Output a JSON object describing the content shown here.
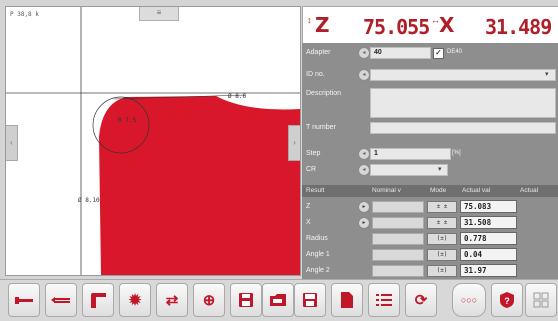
{
  "canvas": {
    "coord_label": "P 38,8 k",
    "top_handle_icon": "drag-handle-icon",
    "left_handle_icon": "chevron-left-icon",
    "right_handle_icon": "chevron-right-icon",
    "radius_label": "R 7.5",
    "width_label": "Ø 8.10",
    "dim_label": "Ø 8.6",
    "shape_color": "#d8182a"
  },
  "readout": {
    "z_icon": "↕",
    "z_name": "Z",
    "z_value": "75.055",
    "x_icon": "↔",
    "x_name": "X",
    "x_value": "31.489",
    "value_color": "#b0202a"
  },
  "panel": {
    "adapter_label": "Adapter",
    "adapter_value": "40",
    "adapter_check_label": "DE40",
    "id_label": "ID no.",
    "description_label": "Description",
    "t_number_label": "T number",
    "step_label": "Step",
    "step_value": "1",
    "step_unit": "[%]",
    "cr_label": "CR",
    "table_headers": [
      "Result",
      "Nominal v",
      "Mode",
      "Actual val",
      "Actual"
    ],
    "rows": [
      {
        "label": "Z",
        "mode": "±  ±",
        "actual": "75.083"
      },
      {
        "label": "X",
        "mode": "±  ±",
        "actual": "31.508"
      },
      {
        "label": "Radius",
        "mode": "(±)",
        "actual": "0.778"
      },
      {
        "label": "Angle 1",
        "mode": "(±)",
        "actual": "0.04"
      },
      {
        "label": "Angle 2",
        "mode": "(±)",
        "actual": "31.97"
      }
    ]
  },
  "toolbar": {
    "buttons": [
      {
        "name": "tool-single-button",
        "icon": "tool-single-icon"
      },
      {
        "name": "tool-double-button",
        "icon": "tool-double-icon"
      },
      {
        "name": "tool-holder-button",
        "icon": "tool-holder-icon"
      },
      {
        "name": "gear-button",
        "icon": "gear-icon"
      },
      {
        "name": "swap-button",
        "icon": "swap-icon"
      },
      {
        "name": "crosshair-button",
        "icon": "crosshair-icon"
      },
      {
        "name": "save-button",
        "icon": "floppy-icon"
      },
      {
        "name": "load-button",
        "icon": "folder-icon"
      },
      {
        "name": "save-as-button",
        "icon": "floppy-plus-icon"
      },
      {
        "name": "document-button",
        "icon": "document-icon"
      },
      {
        "name": "list-button",
        "icon": "list-icon"
      },
      {
        "name": "refresh-button",
        "icon": "refresh-icon"
      },
      {
        "name": "more-button",
        "icon": "more-icon"
      },
      {
        "name": "info-button",
        "icon": "info-icon"
      },
      {
        "name": "grid-button",
        "icon": "grid-icon"
      }
    ]
  }
}
